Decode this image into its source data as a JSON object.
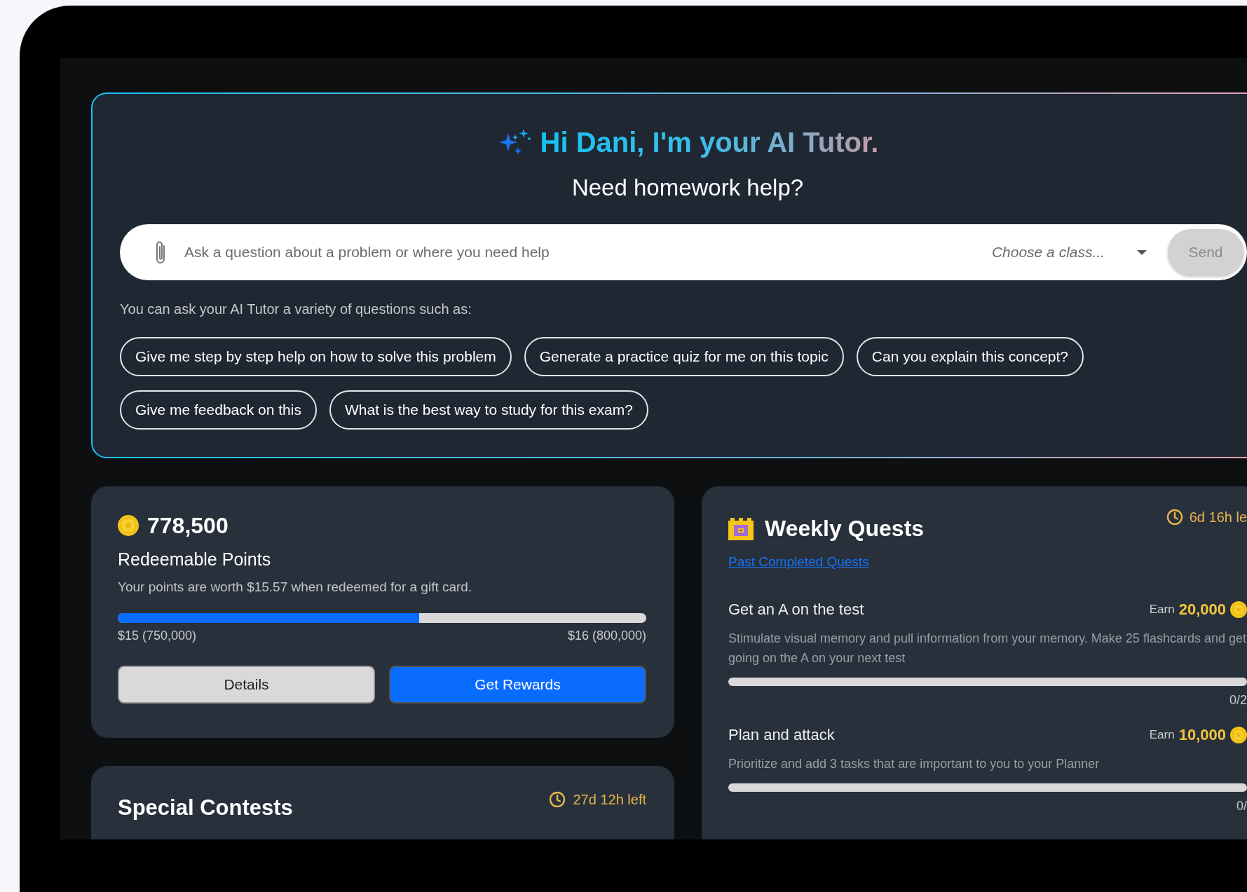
{
  "hero": {
    "greeting": "Hi Dani, I'm your AI Tutor.",
    "subtitle": "Need homework help?",
    "question_field": {
      "placeholder": "Ask a question about a problem or where you need help"
    },
    "class_select": {
      "placeholder": "Choose a class..."
    },
    "send_button": {
      "label": "Send",
      "disabled": true
    },
    "hint": "You can ask your AI Tutor a variety of questions such as:",
    "suggestions": [
      {
        "label": "Give me step by step help on how to solve this problem"
      },
      {
        "label": "Generate a practice quiz for me on this topic"
      },
      {
        "label": "Can you explain this concept?"
      },
      {
        "label": "Give me feedback on this"
      },
      {
        "label": "What is the best way to study for this exam?"
      }
    ]
  },
  "points": {
    "total": "778,500",
    "title": "Redeemable Points",
    "note": "Your points are worth $15.57 when redeemed for a gift card.",
    "progress": {
      "level": 0.57,
      "start_label": "$15 (750,000)",
      "end_label": "$16 (800,000)"
    },
    "buttons": [
      {
        "label": "Details",
        "kind": "secondary"
      },
      {
        "label": "Get Rewards",
        "kind": "primary"
      }
    ]
  },
  "contests": {
    "title": "Special Contests",
    "time_left": "27d 12h left"
  },
  "quests": {
    "title": "Weekly Quests",
    "time_left": "6d 16h le",
    "link": "Past Completed Quests",
    "items": [
      {
        "title": "Get an A on the test",
        "earn_label": "Earn",
        "reward": "20,000",
        "description": "Stimulate visual memory and pull information from your memory. Make 25 flashcards and get going on the A on your next test",
        "level": 0,
        "count": "0/2"
      },
      {
        "title": "Plan and attack",
        "earn_label": "Earn",
        "reward": "10,000",
        "description": "Prioritize and add 3 tasks that are important to you to your Planner",
        "level": 0,
        "count": "0/"
      }
    ]
  }
}
